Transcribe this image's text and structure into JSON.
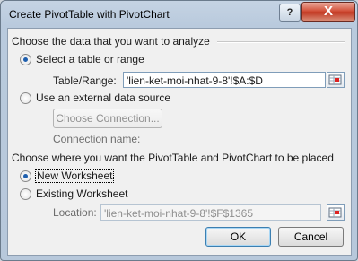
{
  "dialog": {
    "title": "Create PivotTable with PivotChart",
    "help_label": "?",
    "close_label": "X"
  },
  "source": {
    "heading": "Choose the data that you want to analyze",
    "option_table_label": "Select a table or range",
    "table_range_label": "Table/Range:",
    "table_range_value": "'lien-ket-moi-nhat-9-8'!$A:$D",
    "option_external_label": "Use an external data source",
    "choose_connection_label": "Choose Connection...",
    "connection_name_label": "Connection name:"
  },
  "destination": {
    "heading": "Choose where you want the PivotTable and PivotChart to be placed",
    "option_new_label": "New Worksheet",
    "option_existing_label": "Existing Worksheet",
    "location_label": "Location:",
    "location_value": "'lien-ket-moi-nhat-9-8'!$F$1365"
  },
  "buttons": {
    "ok_label": "OK",
    "cancel_label": "Cancel"
  },
  "selection": {
    "source": "table",
    "destination": "new"
  },
  "colors": {
    "title_bar": "#c5d3e3",
    "close_button": "#c23a23",
    "radio_selected": "#1e5fae"
  }
}
